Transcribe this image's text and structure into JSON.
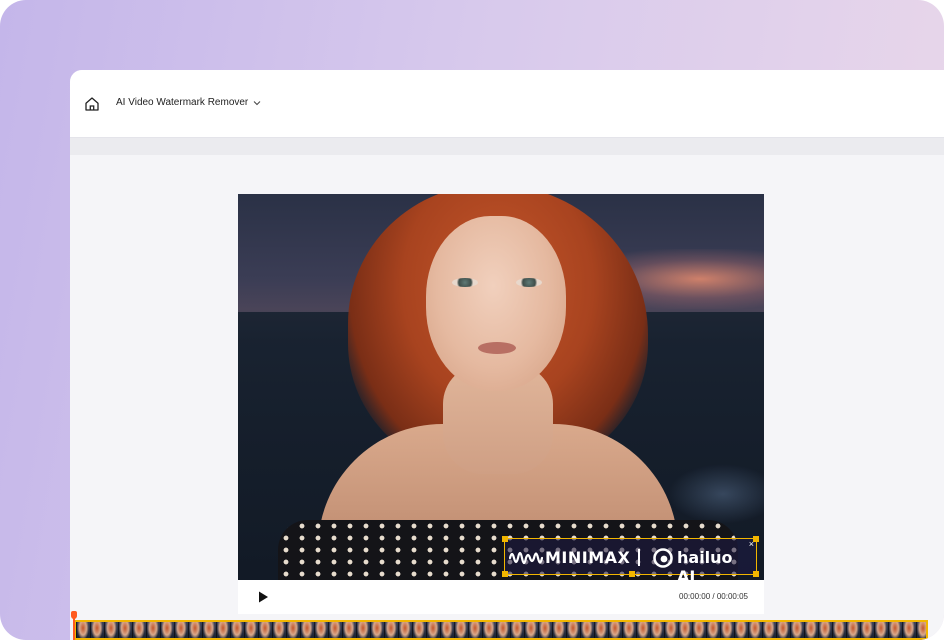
{
  "header": {
    "tool_name": "AI Video Watermark Remover",
    "home_icon": "home-icon",
    "dropdown_icon": "chevron-down-icon"
  },
  "watermark": {
    "brand_1": "MINIMAX",
    "separator": "|",
    "brand_2": "hailuo AI",
    "close_glyph": "×"
  },
  "player": {
    "play_icon": "play-icon",
    "current_time": "00:00:00",
    "time_separator": "/",
    "duration": "00:00:05"
  },
  "timeline": {
    "playhead_position": 0
  },
  "colors": {
    "accent": "#f2b600",
    "playhead": "#ff5a1f",
    "background_gradient_start": "#c4b6ea",
    "background_gradient_end": "#ead8ea"
  }
}
